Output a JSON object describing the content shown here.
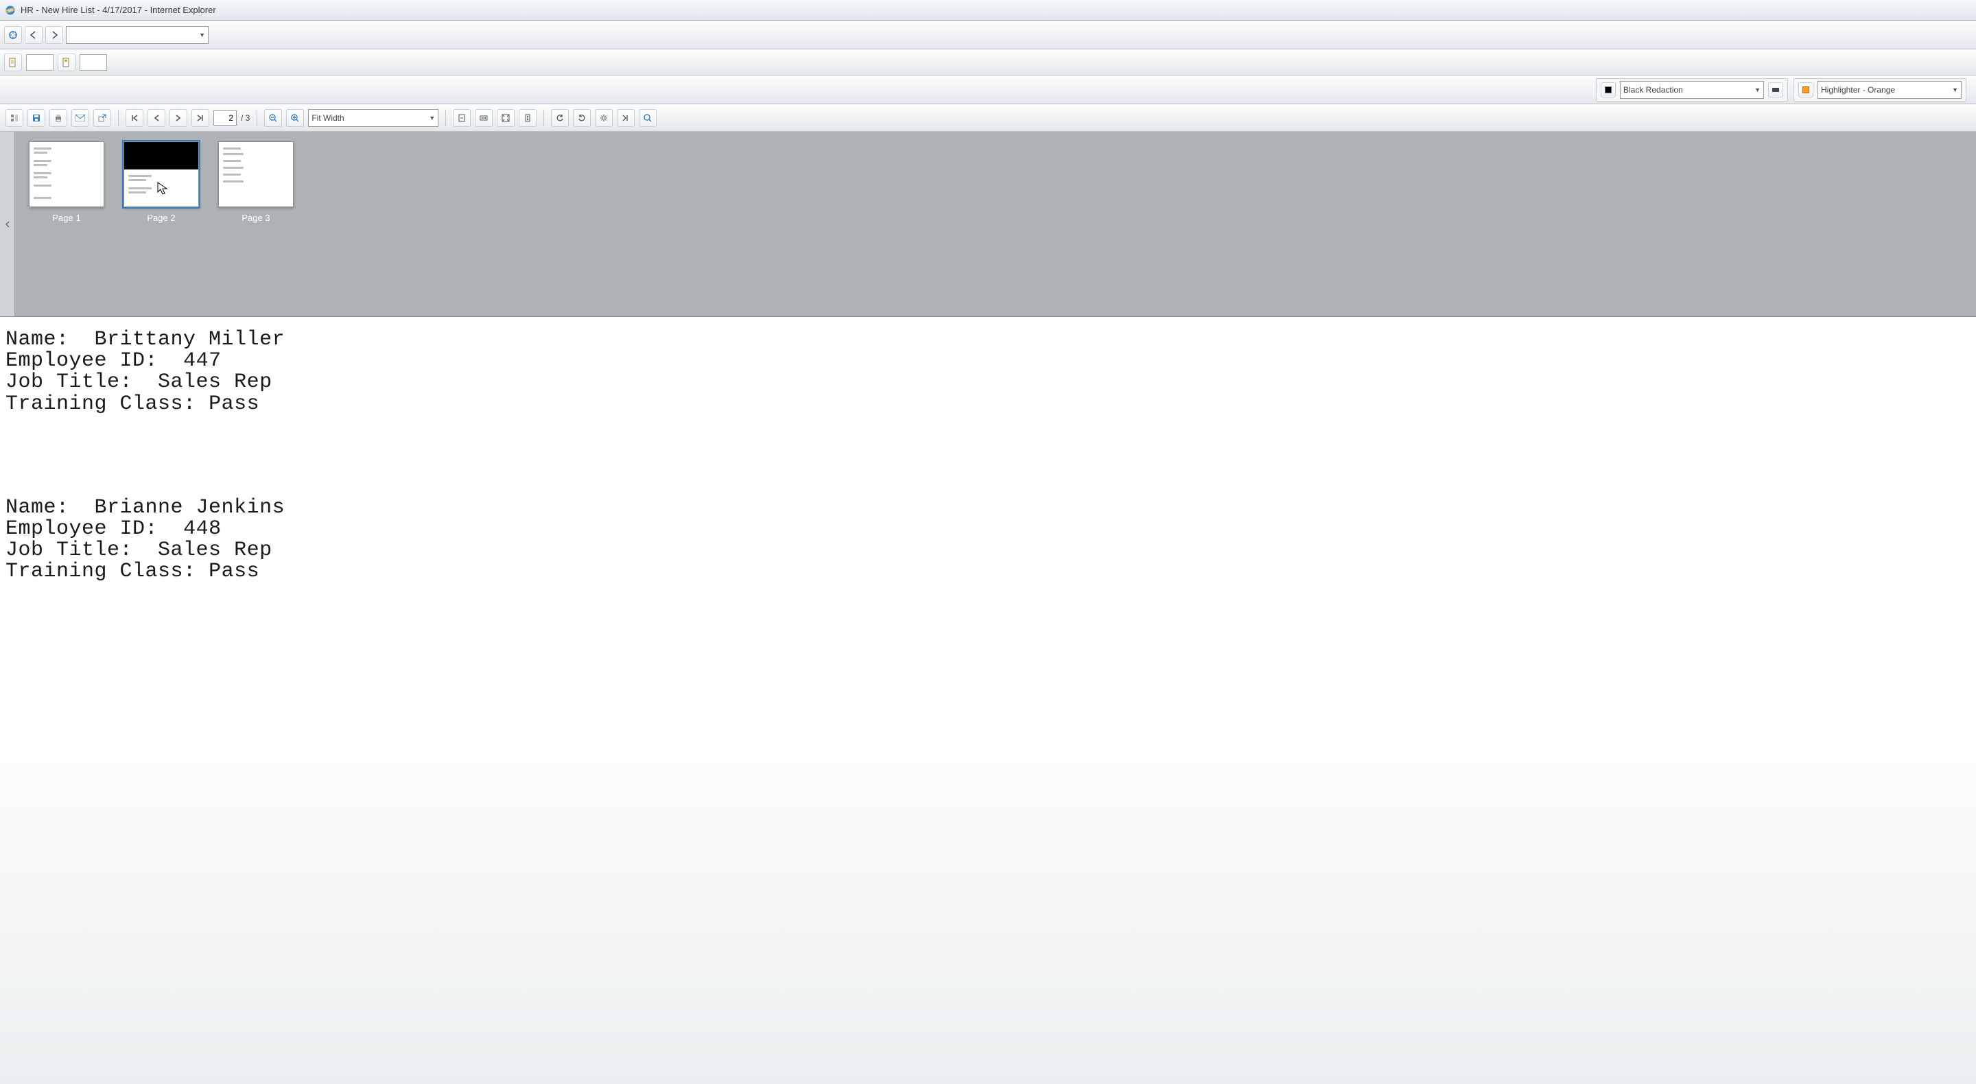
{
  "window": {
    "title": "HR - New Hire List - 4/17/2017 - Internet Explorer"
  },
  "nav_combo": {
    "value": ""
  },
  "redaction": {
    "mode_label": "Black Redaction",
    "highlighter_label": "Highlighter - Orange"
  },
  "pagenav": {
    "current": "2",
    "total_label": "/ 3"
  },
  "zoom": {
    "mode": "Fit Width"
  },
  "thumbnails": {
    "items": [
      {
        "label": "Page 1"
      },
      {
        "label": "Page 2"
      },
      {
        "label": "Page 3"
      }
    ]
  },
  "document": {
    "records": [
      {
        "name_label": "Name:",
        "name": "Brittany Miller",
        "id_label": "Employee ID:",
        "id": "447",
        "title_label": "Job Title:",
        "title": "Sales Rep",
        "training_label": "Training Class:",
        "training": "Pass"
      },
      {
        "name_label": "Name:",
        "name": "Brianne Jenkins",
        "id_label": "Employee ID:",
        "id": "448",
        "title_label": "Job Title:",
        "title": "Sales Rep",
        "training_label": "Training Class:",
        "training": "Pass"
      }
    ]
  }
}
